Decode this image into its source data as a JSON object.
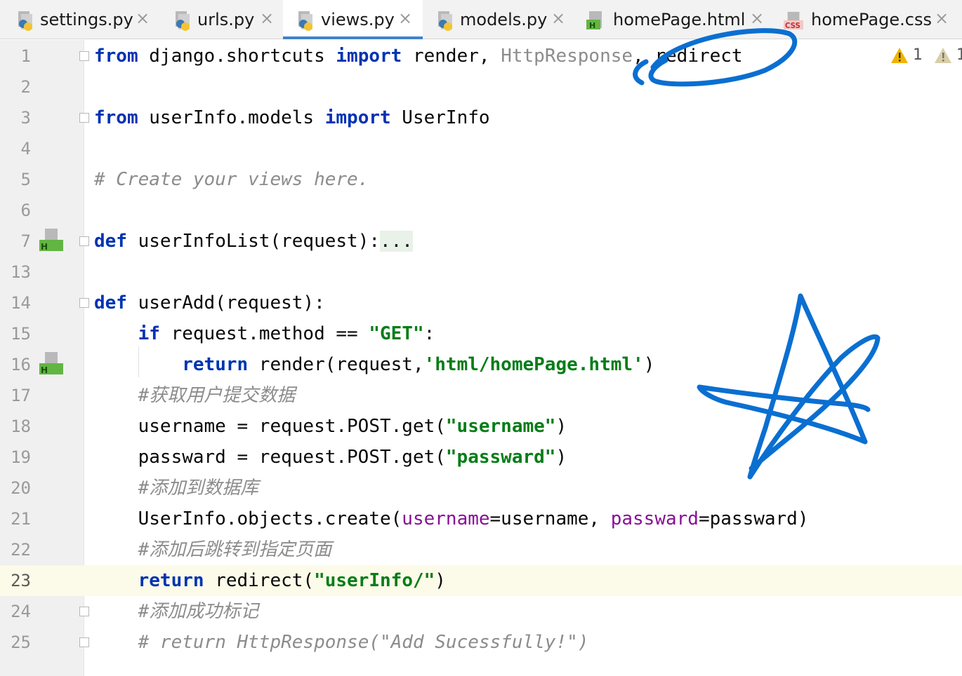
{
  "tabs": [
    {
      "label": "settings.py",
      "icon": "python-file-icon"
    },
    {
      "label": "urls.py",
      "icon": "python-file-icon"
    },
    {
      "label": "views.py",
      "icon": "python-file-icon",
      "active": true
    },
    {
      "label": "models.py",
      "icon": "python-file-icon"
    },
    {
      "label": "homePage.html",
      "icon": "html-file-icon"
    },
    {
      "label": "homePage.css",
      "icon": "css-file-icon"
    }
  ],
  "close_glyph": "×",
  "warnings": {
    "warn_count": "1",
    "weak_warn_count": "1"
  },
  "current_line": "23",
  "lines": [
    {
      "n": "1",
      "t1": "from",
      "t2": " django.shortcuts ",
      "t3": "import",
      "t4": " render, ",
      "t5": "HttpResponse",
      "t6": ", redirect"
    },
    {
      "n": "2"
    },
    {
      "n": "3",
      "t1": "from",
      "t2": " userInfo.models ",
      "t3": "import",
      "t4": " UserInfo"
    },
    {
      "n": "4"
    },
    {
      "n": "5",
      "t1": "# Create your views here."
    },
    {
      "n": "6"
    },
    {
      "n": "7",
      "t1": "def",
      "t2": " userInfoList(request):",
      "t3": "..."
    },
    {
      "n": "13"
    },
    {
      "n": "14",
      "t1": "def",
      "t2": " userAdd(request):"
    },
    {
      "n": "15",
      "t1": "    ",
      "t2": "if",
      "t3": " request.method == ",
      "t4": "\"GET\"",
      "t5": ":"
    },
    {
      "n": "16",
      "t1": "        ",
      "t2": "return",
      "t3": " render(request,",
      "t4": "'html/homePage.html'",
      "t5": ")"
    },
    {
      "n": "17",
      "t1": "    ",
      "t2": "#获取用户提交数据"
    },
    {
      "n": "18",
      "t1": "    username = request.POST.get(",
      "t2": "\"username\"",
      "t3": ")"
    },
    {
      "n": "19",
      "t1": "    passward = request.POST.get(",
      "t2": "\"passward\"",
      "t3": ")"
    },
    {
      "n": "20",
      "t1": "    ",
      "t2": "#添加到数据库"
    },
    {
      "n": "21",
      "t1": "    UserInfo.objects.create(",
      "t2": "username",
      "t3": "=username, ",
      "t4": "passward",
      "t5": "=passward)"
    },
    {
      "n": "22",
      "t1": "    ",
      "t2": "#添加后跳转到指定页面"
    },
    {
      "n": "23",
      "t1": "    ",
      "t2": "return",
      "t3": " redirect(",
      "t4": "\"userInfo/\"",
      "t5": ")"
    },
    {
      "n": "24",
      "t1": "    ",
      "t2": "#添加成功标记"
    },
    {
      "n": "25",
      "t1": "    ",
      "t2": "# return HttpResponse(\"Add Sucessfully!\")"
    }
  ],
  "colors": {
    "accent": "#4083c9",
    "keyword": "#0033b3",
    "string": "#067d17",
    "comment": "#8c8c8c",
    "annotation_ink": "#0a6fd1"
  }
}
